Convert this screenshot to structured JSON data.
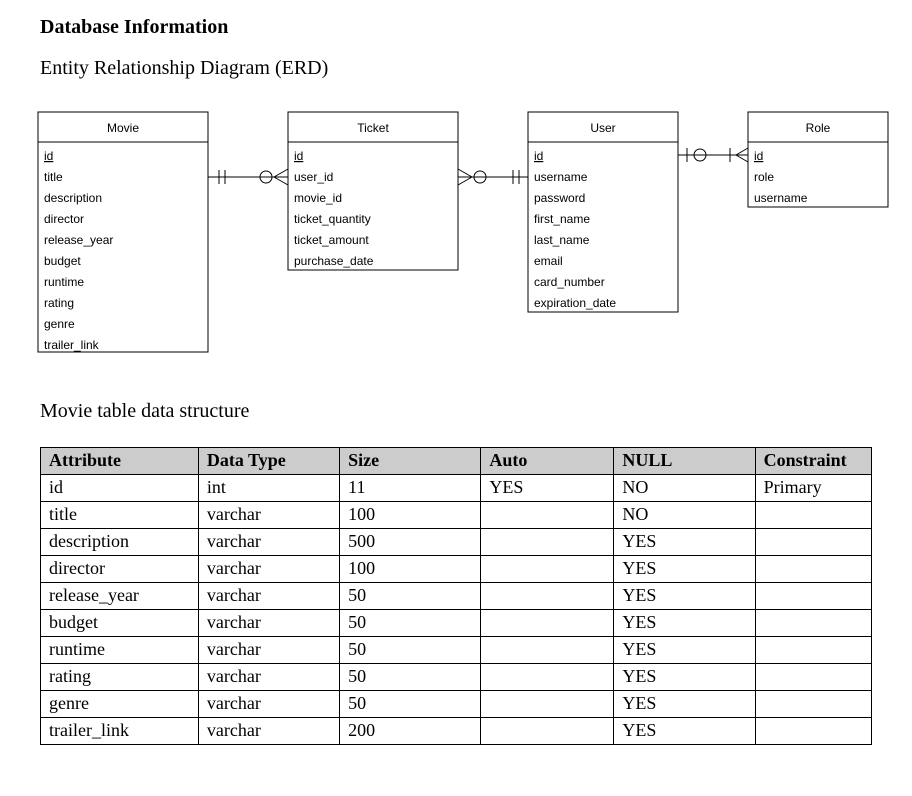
{
  "heading": "Database Information",
  "sub_heading": "Entity Relationship Diagram (ERD)",
  "erd": {
    "entities": [
      {
        "name": "Movie",
        "attributes": [
          "id",
          "title",
          "description",
          "director",
          "release_year",
          "budget",
          "runtime",
          "rating",
          "genre",
          "trailer_link"
        ],
        "primary_key": "id"
      },
      {
        "name": "Ticket",
        "attributes": [
          "id",
          "user_id",
          "movie_id",
          "ticket_quantity",
          "ticket_amount",
          "purchase_date"
        ],
        "primary_key": "id"
      },
      {
        "name": "User",
        "attributes": [
          "id",
          "username",
          "password",
          "first_name",
          "last_name",
          "email",
          "card_number",
          "expiration_date"
        ],
        "primary_key": "id"
      },
      {
        "name": "Role",
        "attributes": [
          "id",
          "role",
          "username"
        ],
        "primary_key": "id"
      }
    ],
    "relationships": [
      {
        "from": "Movie",
        "to": "Ticket",
        "from_card": "one-and-only-one",
        "to_card": "zero-or-many"
      },
      {
        "from": "Ticket",
        "to": "User",
        "from_card": "zero-or-many",
        "to_card": "one-and-only-one"
      },
      {
        "from": "User",
        "to": "Role",
        "from_card": "one-and-only-one_with_zero",
        "to_card": "one-or-many"
      }
    ]
  },
  "table_section_label": "Movie table data structure",
  "schema": {
    "columns": [
      "Attribute",
      "Data Type",
      "Size",
      "Auto",
      "NULL",
      "Constraint"
    ],
    "rows": [
      {
        "Attribute": "id",
        "Data Type": "int",
        "Size": "11",
        "Auto": "YES",
        "NULL": "NO",
        "Constraint": "Primary"
      },
      {
        "Attribute": "title",
        "Data Type": "varchar",
        "Size": "100",
        "Auto": "",
        "NULL": "NO",
        "Constraint": ""
      },
      {
        "Attribute": "description",
        "Data Type": "varchar",
        "Size": "500",
        "Auto": "",
        "NULL": "YES",
        "Constraint": ""
      },
      {
        "Attribute": "director",
        "Data Type": "varchar",
        "Size": "100",
        "Auto": "",
        "NULL": "YES",
        "Constraint": ""
      },
      {
        "Attribute": "release_year",
        "Data Type": "varchar",
        "Size": "50",
        "Auto": "",
        "NULL": "YES",
        "Constraint": ""
      },
      {
        "Attribute": "budget",
        "Data Type": "varchar",
        "Size": "50",
        "Auto": "",
        "NULL": "YES",
        "Constraint": ""
      },
      {
        "Attribute": "runtime",
        "Data Type": "varchar",
        "Size": "50",
        "Auto": "",
        "NULL": "YES",
        "Constraint": ""
      },
      {
        "Attribute": "rating",
        "Data Type": "varchar",
        "Size": "50",
        "Auto": "",
        "NULL": "YES",
        "Constraint": ""
      },
      {
        "Attribute": "genre",
        "Data Type": "varchar",
        "Size": "50",
        "Auto": "",
        "NULL": "YES",
        "Constraint": ""
      },
      {
        "Attribute": "trailer_link",
        "Data Type": "varchar",
        "Size": "200",
        "Auto": "",
        "NULL": "YES",
        "Constraint": ""
      }
    ]
  }
}
